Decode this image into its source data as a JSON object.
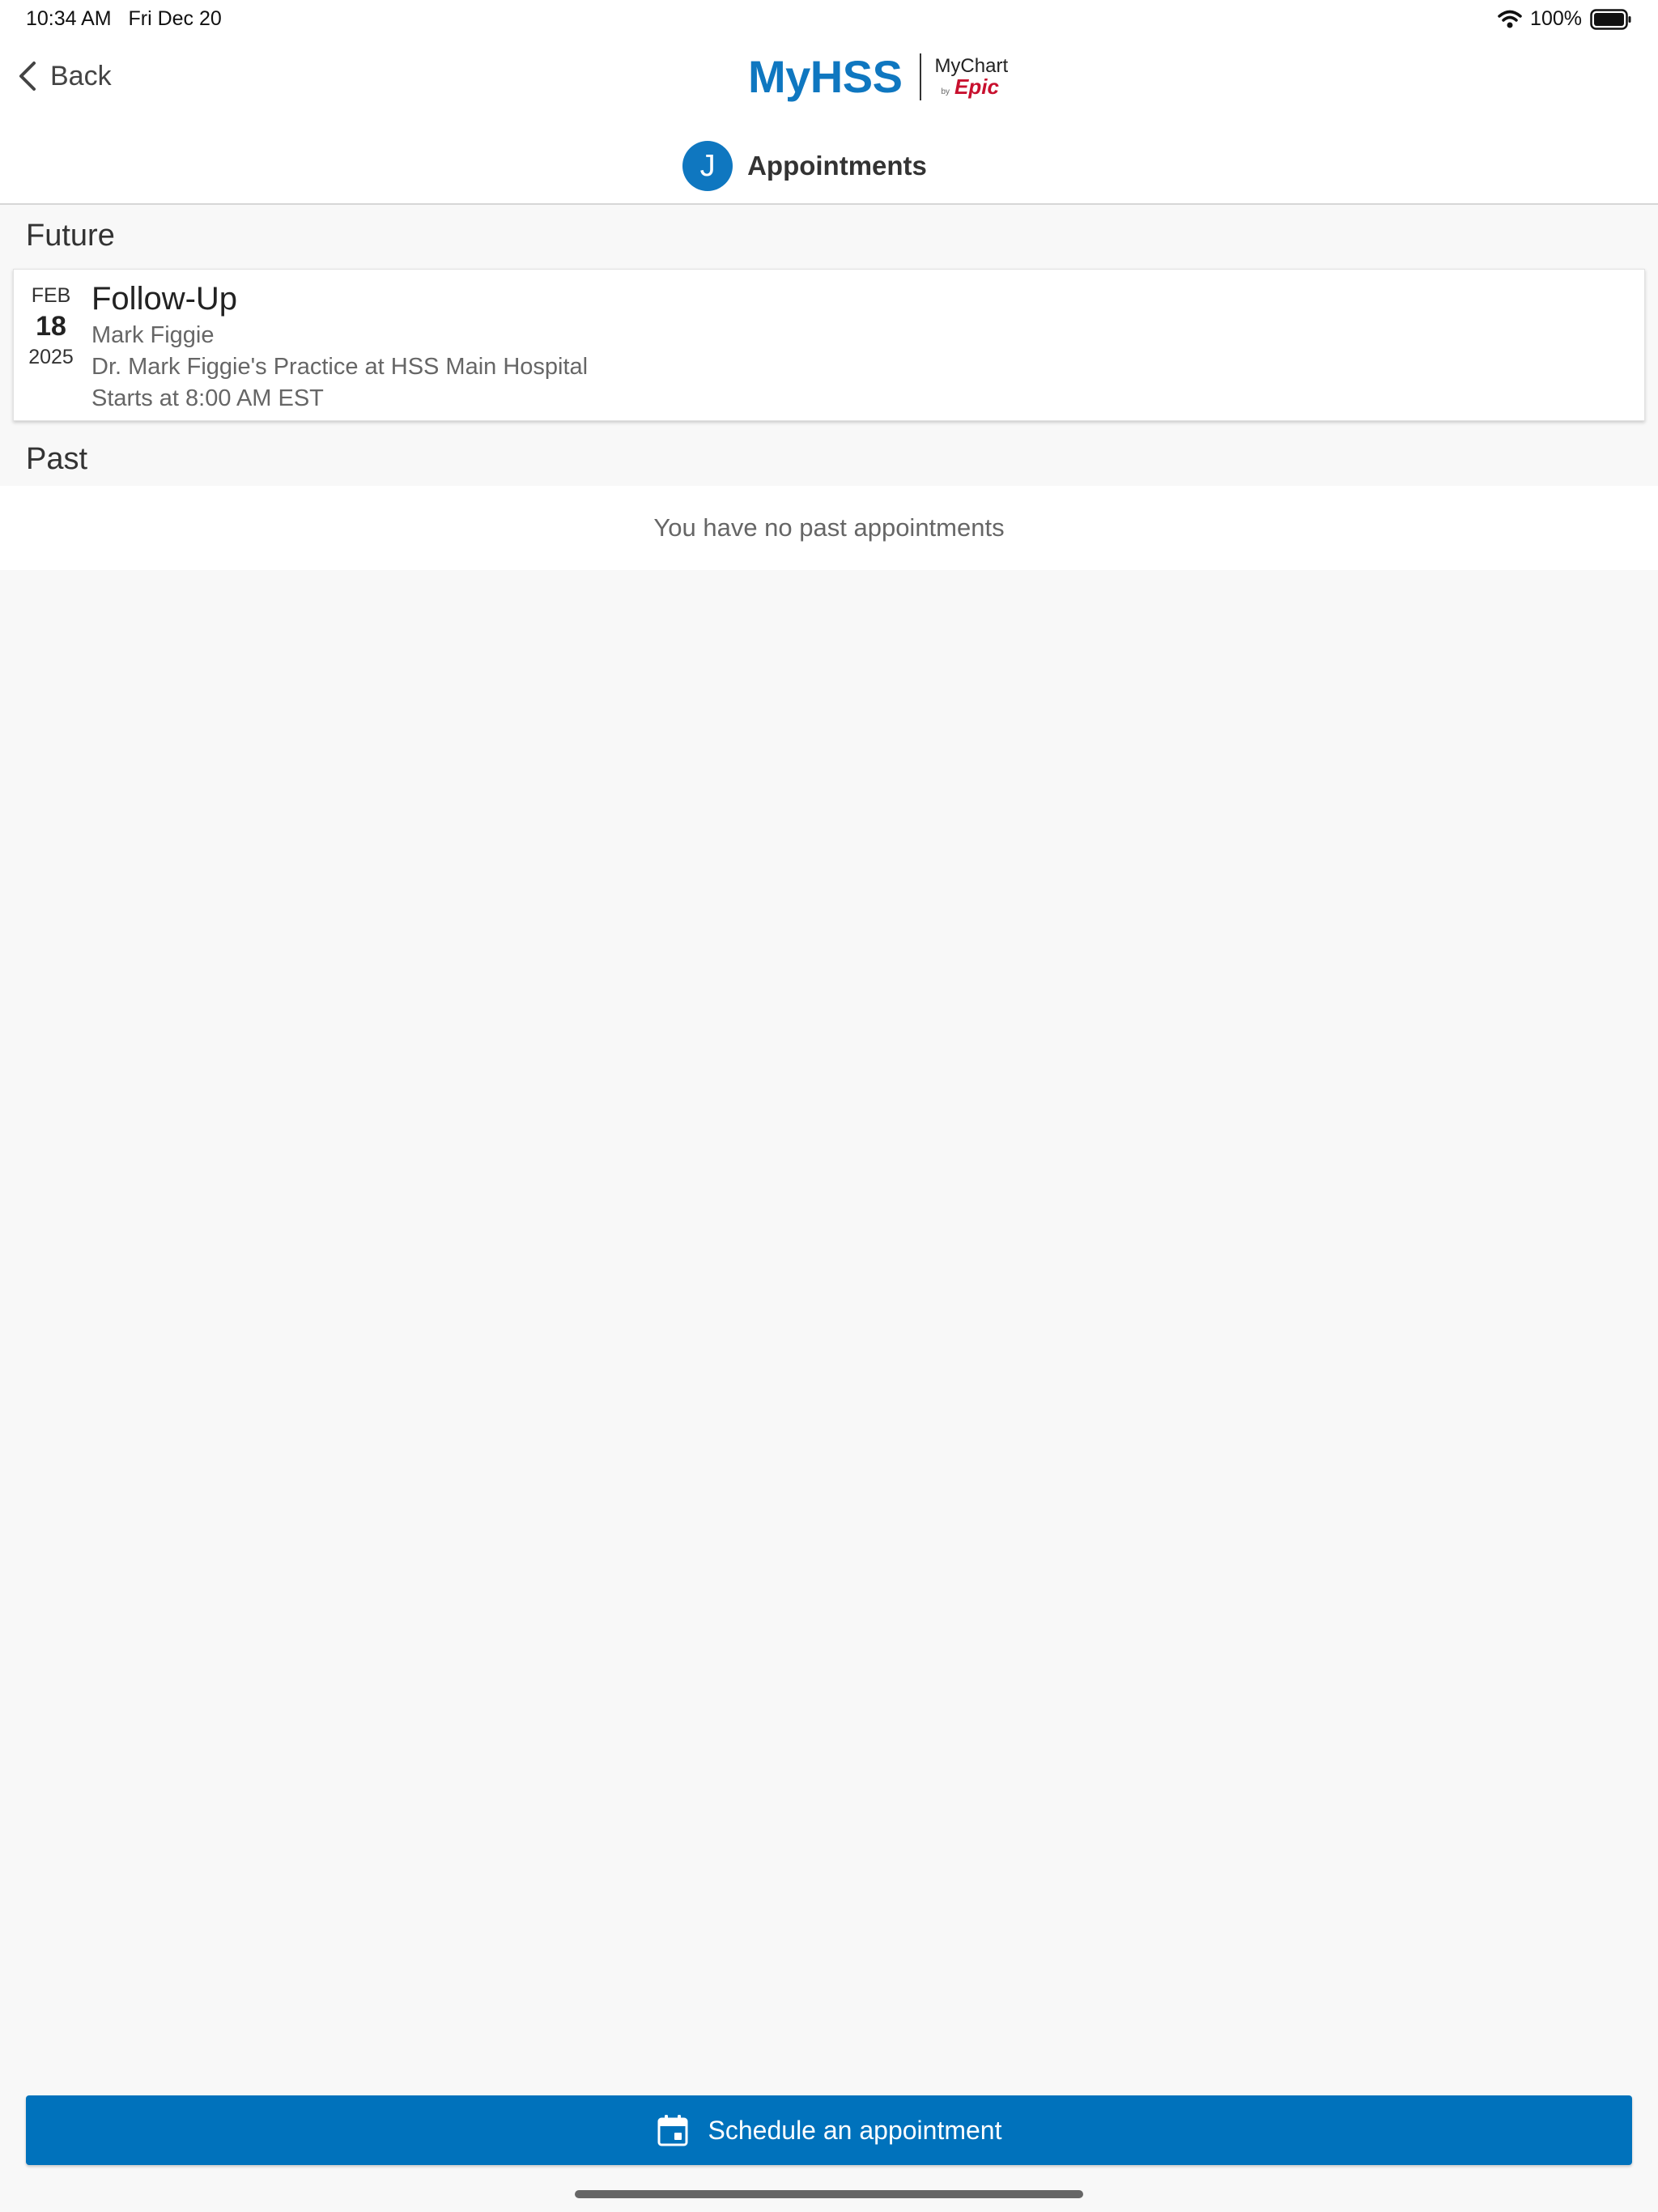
{
  "status_bar": {
    "time": "10:34 AM",
    "date": "Fri Dec 20",
    "battery": "100%"
  },
  "header": {
    "back_label": "Back",
    "brand": "MyHSS",
    "partner_brand": "MyChart",
    "partner_by": "by",
    "partner_vendor": "Epic",
    "avatar_initial": "J",
    "title": "Appointments"
  },
  "sections": {
    "future_title": "Future",
    "past_title": "Past",
    "past_empty": "You have no past appointments"
  },
  "appointment": {
    "month": "FEB",
    "day": "18",
    "year": "2025",
    "type": "Follow-Up",
    "provider": "Mark Figgie",
    "location": "Dr. Mark Figgie's Practice at HSS Main Hospital",
    "time": "Starts at 8:00 AM EST"
  },
  "footer": {
    "schedule_label": "Schedule an appointment"
  },
  "colors": {
    "brand_blue": "#0f77c0",
    "button_blue": "#0072bc",
    "epic_red": "#c8102e"
  }
}
